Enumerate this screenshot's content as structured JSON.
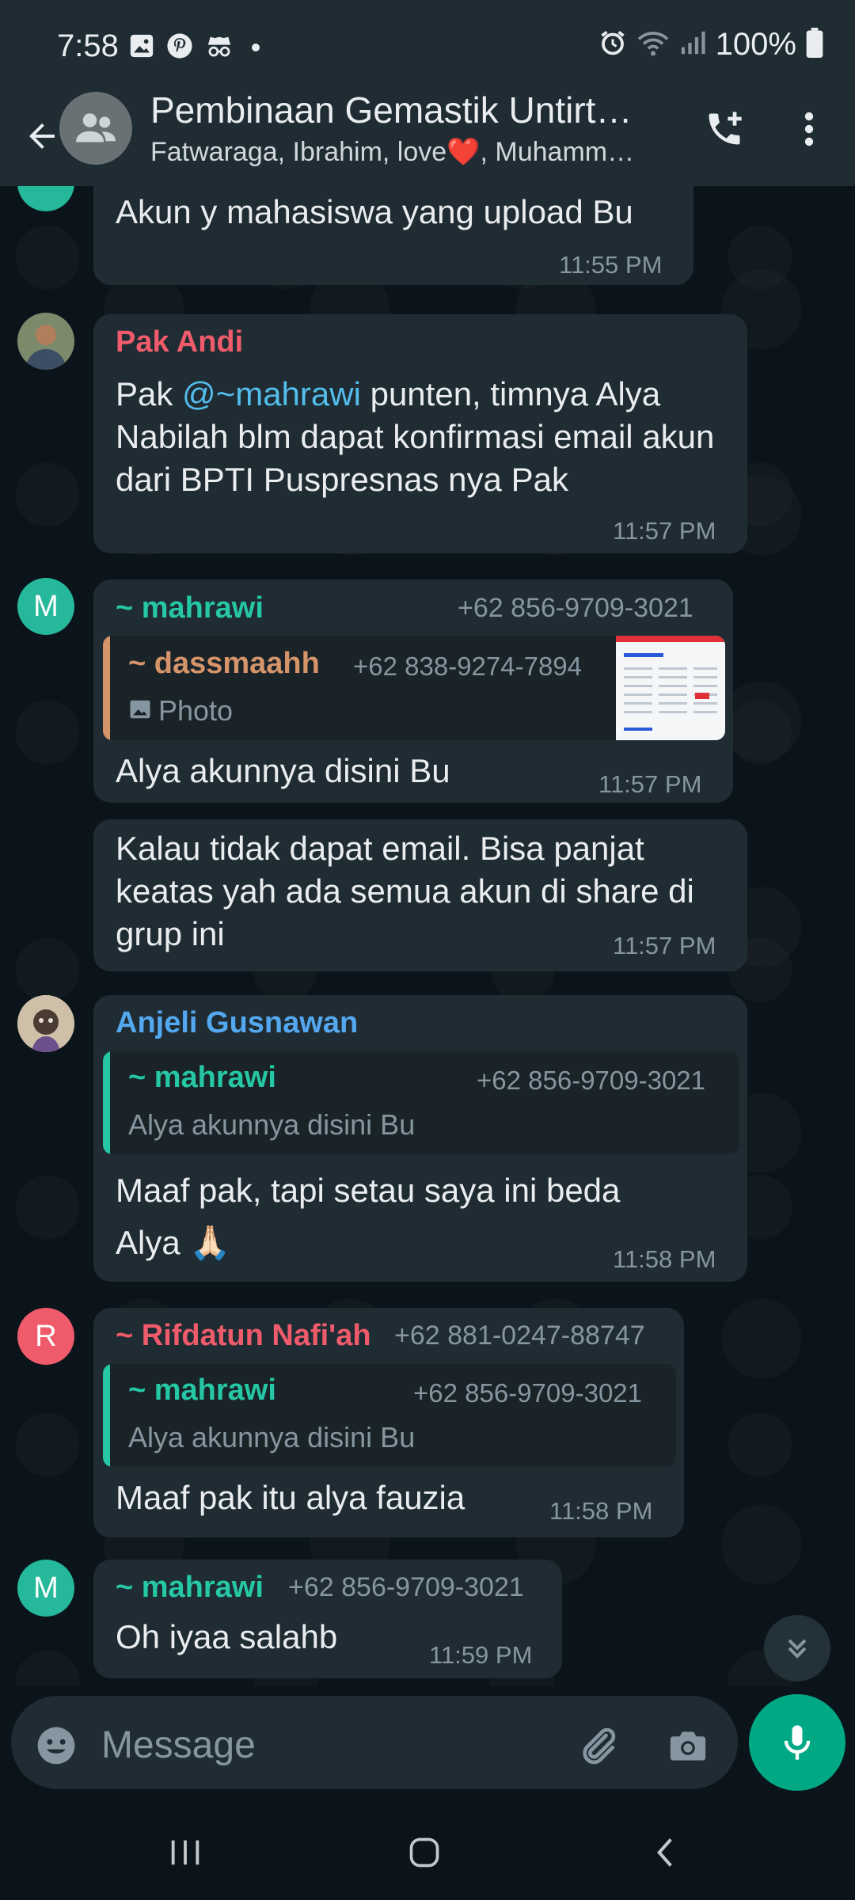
{
  "status_bar": {
    "time": "7:58",
    "battery": "100%"
  },
  "header": {
    "title": "Pembinaan Gemastik Untirt…",
    "subtitle": "Fatwaraga, Ibrahim, love❤️, Muhamm…"
  },
  "messages": [
    {
      "text": "Akun y mahasiswa yang upload Bu",
      "time": "11:55 PM"
    },
    {
      "sender": "Pak Andi",
      "sender_color": "#ef5b6b",
      "text_pre": "Pak ",
      "mention": "@~mahrawi",
      "text_post": " punten, timnya Alya Nabilah blm dapat konfirmasi email akun dari BPTI Puspresnas nya Pak",
      "time": "11:57 PM"
    },
    {
      "avatar_letter": "M",
      "sender": "~ mahrawi",
      "sender_color": "#25c7a4",
      "phone": "+62 856-9709-3021",
      "quote": {
        "sender": "~ dassmaahh",
        "sender_color": "#d5946a",
        "phone": "+62 838-9274-7894",
        "type_icon": "photo-icon",
        "text": "Photo"
      },
      "text": "Alya akunnya disini Bu",
      "time": "11:57 PM"
    },
    {
      "text": "Kalau tidak dapat email. Bisa panjat keatas yah ada semua akun di share di grup ini",
      "time": "11:57 PM"
    },
    {
      "sender": "Anjeli Gusnawan",
      "sender_color": "#53a8f0",
      "quote": {
        "sender": "~ mahrawi",
        "sender_color": "#25c7a4",
        "phone": "+62 856-9709-3021",
        "text": "Alya akunnya disini Bu"
      },
      "text": "Maaf pak, tapi setau saya ini beda Alya 🙏🏻",
      "time": "11:58 PM"
    },
    {
      "avatar_letter": "R",
      "sender": "~ Rifdatun Nafi'ah",
      "sender_color": "#ef5b6b",
      "phone": "+62 881-0247-88747",
      "quote": {
        "sender": "~ mahrawi",
        "sender_color": "#25c7a4",
        "phone": "+62 856-9709-3021",
        "text": "Alya akunnya disini Bu"
      },
      "text": "Maaf pak itu alya fauzia",
      "time": "11:58 PM"
    },
    {
      "avatar_letter": "M",
      "sender": "~ mahrawi",
      "sender_color": "#25c7a4",
      "phone": "+62 856-9709-3021",
      "text": "Oh iyaa salahb",
      "time": "11:59 PM"
    }
  ],
  "input": {
    "placeholder": "Message"
  },
  "colors": {
    "accent": "#00a884",
    "bubble": "#202c33",
    "bar": "#1f2c34"
  }
}
